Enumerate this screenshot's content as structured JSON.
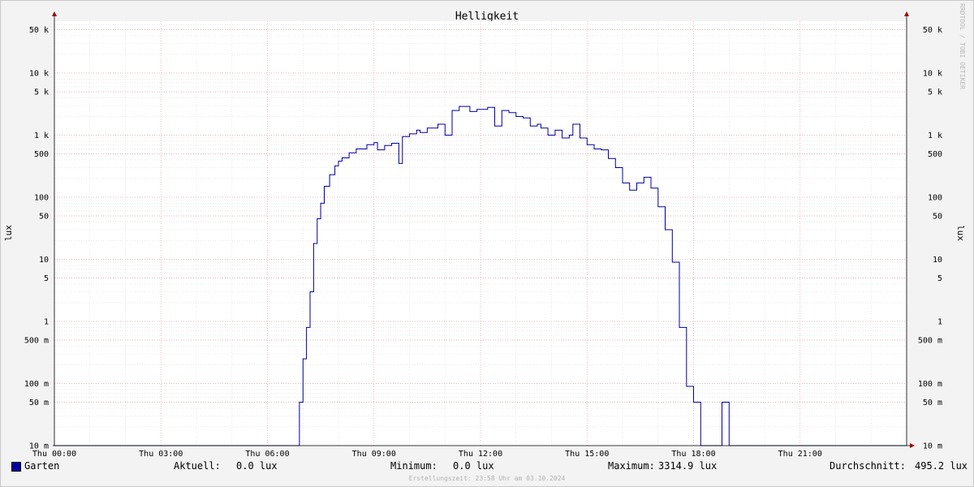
{
  "chart_data": {
    "type": "line",
    "title": "Helligkeit",
    "ylabel": "lux",
    "yscale": "log",
    "ylim": [
      10,
      70000
    ],
    "xlim_hours": [
      0,
      24
    ],
    "x_ticks": [
      "Thu 00:00",
      "Thu 03:00",
      "Thu 06:00",
      "Thu 09:00",
      "Thu 12:00",
      "Thu 15:00",
      "Thu 18:00",
      "Thu 21:00"
    ],
    "y_ticks": [
      {
        "value": 10,
        "label": "10 m"
      },
      {
        "value": 50,
        "label": "50 m"
      },
      {
        "value": 100,
        "label": "100 m"
      },
      {
        "value": 500,
        "label": "500 m"
      },
      {
        "value": 1000,
        "label": "1"
      },
      {
        "value": 5000,
        "label": "5"
      },
      {
        "value": 10000,
        "label": "10"
      },
      {
        "value": 50000,
        "label": "50"
      },
      {
        "value": 100000,
        "label": "100"
      },
      {
        "value": 500000,
        "label": "500"
      },
      {
        "value": 1000000,
        "label": "1 k"
      },
      {
        "value": 5000000,
        "label": "5 k"
      },
      {
        "value": 10000000,
        "label": "10 k"
      },
      {
        "value": 50000000,
        "label": "50 k"
      }
    ],
    "series": [
      {
        "name": "Garten",
        "color": "#0000a0",
        "note_units": "values in milli-lux (axis labels with SI prefixes)",
        "x_hours": [
          0,
          6.85,
          6.9,
          7.0,
          7.1,
          7.2,
          7.3,
          7.4,
          7.5,
          7.6,
          7.75,
          7.9,
          8.0,
          8.1,
          8.3,
          8.5,
          8.8,
          9.0,
          9.1,
          9.3,
          9.5,
          9.7,
          9.8,
          10.0,
          10.2,
          10.3,
          10.5,
          10.8,
          11.0,
          11.2,
          11.4,
          11.7,
          11.9,
          12.2,
          12.4,
          12.6,
          12.8,
          13.0,
          13.2,
          13.4,
          13.6,
          13.7,
          13.9,
          14.1,
          14.3,
          14.5,
          14.6,
          14.8,
          15.0,
          15.2,
          15.4,
          15.6,
          15.8,
          16.0,
          16.2,
          16.4,
          16.6,
          16.8,
          17.0,
          17.2,
          17.4,
          17.6,
          17.8,
          18.0,
          18.2,
          18.4,
          18.6,
          18.8,
          19.0,
          19.2,
          19.4,
          19.6,
          19.8,
          19.9,
          20.0,
          20.5,
          20.6,
          20.61,
          20.62,
          21.0,
          21.5,
          24
        ],
        "y_mlux": [
          10,
          10,
          50,
          250,
          800,
          3000,
          18000,
          45000,
          80000,
          150000,
          230000,
          320000,
          380000,
          430000,
          520000,
          600000,
          700000,
          760000,
          580000,
          680000,
          740000,
          350000,
          950000,
          1050000,
          1200000,
          1100000,
          1300000,
          1500000,
          1000000,
          2500000,
          2900000,
          2400000,
          2600000,
          2800000,
          1400000,
          2500000,
          2300000,
          2000000,
          1900000,
          1400000,
          1500000,
          1300000,
          1000000,
          1200000,
          900000,
          1000000,
          1500000,
          900000,
          700000,
          600000,
          580000,
          420000,
          300000,
          170000,
          130000,
          170000,
          210000,
          140000,
          70000,
          30000,
          9000,
          800,
          90,
          50,
          10,
          10,
          10,
          50,
          10,
          10,
          10,
          10,
          10,
          10,
          10,
          10,
          10,
          10,
          10,
          10,
          10,
          10
        ]
      }
    ]
  },
  "legend": {
    "series_label": "Garten",
    "aktuell_label": "Aktuell:",
    "aktuell_value": "0.0 lux",
    "minimum_label": "Minimum:",
    "minimum_value": "0.0 lux",
    "maximum_label": "Maximum:",
    "maximum_value": "3314.9 lux",
    "durchschnitt_label": "Durchschnitt:",
    "durchschnitt_value": "495.2 lux"
  },
  "footer": "Erstellungszeit: 23:58 Uhr am 03.10.2024",
  "vertical_label": "RRDTOOL / TOBI OETIKER"
}
